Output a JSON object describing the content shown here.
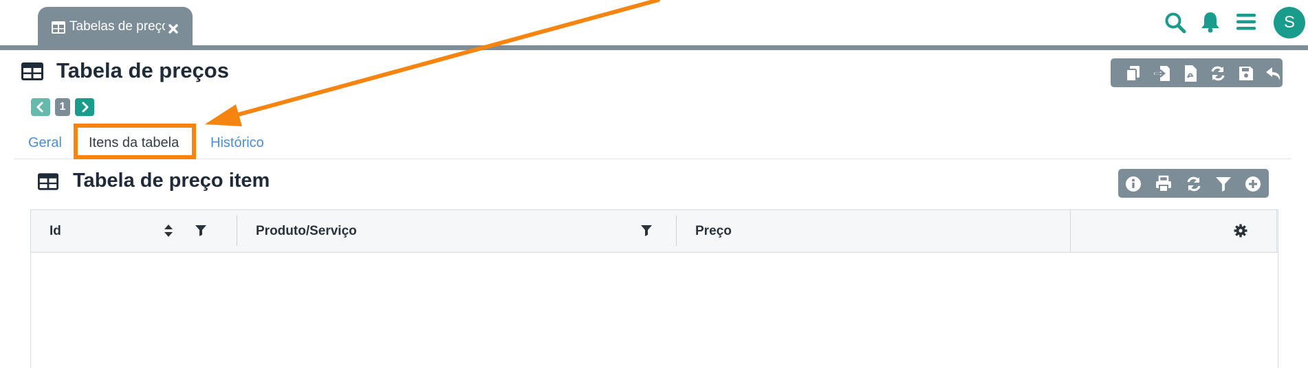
{
  "window_tab": {
    "title": "Tabelas de preços",
    "icon": "table-icon",
    "close_icon": "close-icon"
  },
  "top_icons": [
    "search-icon",
    "bell-icon",
    "menu-icon"
  ],
  "user": {
    "avatar_initial": "S"
  },
  "colors": {
    "accent": "#1a9c8c",
    "toolbar_bg": "#7d8d97",
    "link": "#4a8fd6",
    "annotation": "#f6840e"
  },
  "page": {
    "title": "Tabela de preços",
    "toolbar_icons": [
      "copy-icon",
      "import-icon",
      "pdf-icon",
      "refresh-icon",
      "save-icon",
      "undo-icon"
    ]
  },
  "pager": {
    "current_page": "1"
  },
  "tabs": [
    {
      "label": "Geral",
      "active": false
    },
    {
      "label": "Itens da tabela",
      "active": true
    },
    {
      "label": "Histórico",
      "active": false
    }
  ],
  "section": {
    "title": "Tabela de preço item",
    "toolbar_icons": [
      "info-icon",
      "print-icon",
      "refresh-icon",
      "filter-icon",
      "add-icon"
    ]
  },
  "table": {
    "columns": [
      {
        "label": "Id",
        "sortable": true,
        "filterable": true
      },
      {
        "label": "Produto/Serviço",
        "sortable": false,
        "filterable": true
      },
      {
        "label": "Preço",
        "sortable": false,
        "filterable": false
      }
    ],
    "settings_icon": "gear-icon",
    "rows": []
  }
}
